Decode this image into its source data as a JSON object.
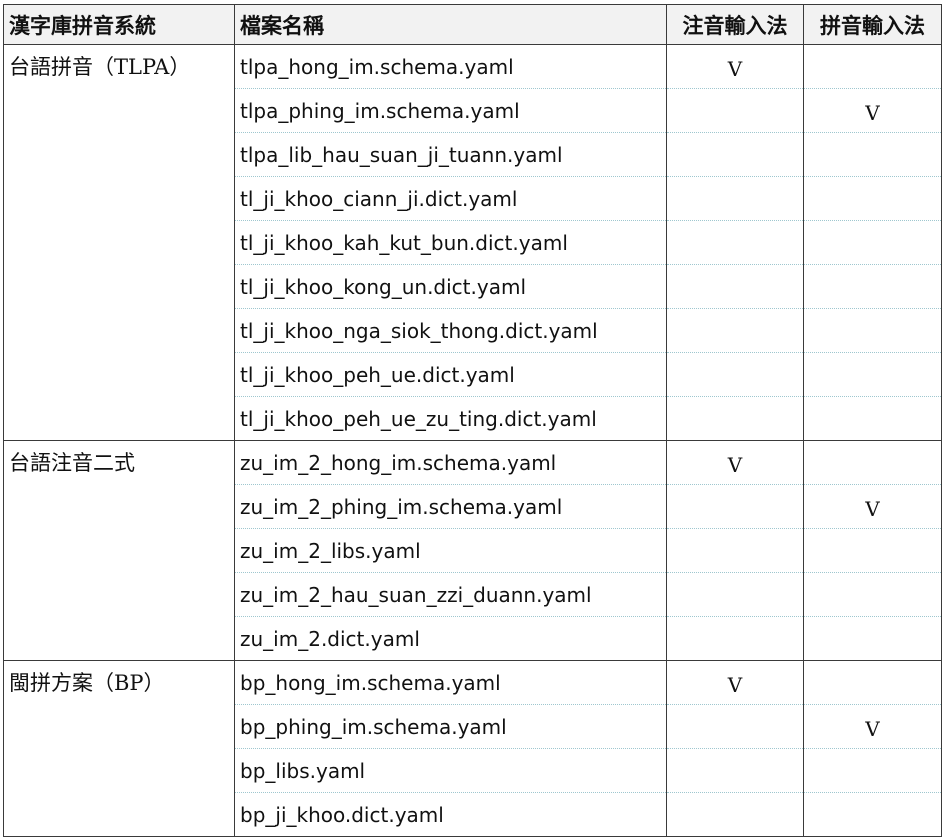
{
  "header": {
    "system": "漢字庫拼音系統",
    "filename": "檔案名稱",
    "zhuyin_ime": "注音輸入法",
    "pinyin_ime": "拼音輸入法"
  },
  "groups": [
    {
      "system": "台語拼音（TLPA）",
      "rows": [
        {
          "file": "tlpa_hong_im.schema.yaml",
          "zhuyin": "V",
          "pinyin": ""
        },
        {
          "file": "tlpa_phing_im.schema.yaml",
          "zhuyin": "",
          "pinyin": "V"
        },
        {
          "file": "tlpa_lib_hau_suan_ji_tuann.yaml",
          "zhuyin": "",
          "pinyin": ""
        },
        {
          "file": "tl_ji_khoo_ciann_ji.dict.yaml",
          "zhuyin": "",
          "pinyin": ""
        },
        {
          "file": "tl_ji_khoo_kah_kut_bun.dict.yaml",
          "zhuyin": "",
          "pinyin": ""
        },
        {
          "file": "tl_ji_khoo_kong_un.dict.yaml",
          "zhuyin": "",
          "pinyin": ""
        },
        {
          "file": "tl_ji_khoo_nga_siok_thong.dict.yaml",
          "zhuyin": "",
          "pinyin": ""
        },
        {
          "file": "tl_ji_khoo_peh_ue.dict.yaml",
          "zhuyin": "",
          "pinyin": ""
        },
        {
          "file": "tl_ji_khoo_peh_ue_zu_ting.dict.yaml",
          "zhuyin": "",
          "pinyin": ""
        }
      ]
    },
    {
      "system": "台語注音二式",
      "rows": [
        {
          "file": "zu_im_2_hong_im.schema.yaml",
          "zhuyin": "V",
          "pinyin": ""
        },
        {
          "file": "zu_im_2_phing_im.schema.yaml",
          "zhuyin": "",
          "pinyin": "V"
        },
        {
          "file": "zu_im_2_libs.yaml",
          "zhuyin": "",
          "pinyin": ""
        },
        {
          "file": "zu_im_2_hau_suan_zzi_duann.yaml",
          "zhuyin": "",
          "pinyin": ""
        },
        {
          "file": "zu_im_2.dict.yaml",
          "zhuyin": "",
          "pinyin": ""
        }
      ]
    },
    {
      "system": "閩拼方案（BP）",
      "rows": [
        {
          "file": "bp_hong_im.schema.yaml",
          "zhuyin": "V",
          "pinyin": ""
        },
        {
          "file": "bp_phing_im.schema.yaml",
          "zhuyin": "",
          "pinyin": "V"
        },
        {
          "file": "bp_libs.yaml",
          "zhuyin": "",
          "pinyin": ""
        },
        {
          "file": "bp_ji_khoo.dict.yaml",
          "zhuyin": "",
          "pinyin": ""
        }
      ]
    }
  ]
}
